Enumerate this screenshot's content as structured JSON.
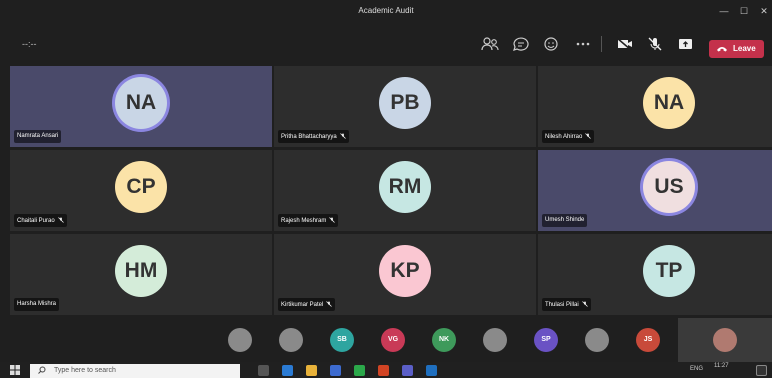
{
  "window": {
    "title": "Academic Audit"
  },
  "toolbar": {
    "timer": "--:--",
    "leave_label": "Leave",
    "leave_color": "#c4314b"
  },
  "colors": {
    "speaking_ring": "#8b86e0",
    "tile_bg": "#2d2d2d",
    "speaking_bg": "#4a4a6a"
  },
  "participants": [
    {
      "initials": "NA",
      "name": "Namrata Ansari",
      "muted": false,
      "speaking": true,
      "avatar_color": "#c9d6e6"
    },
    {
      "initials": "PB",
      "name": "Pritha Bhattacharyya",
      "muted": true,
      "speaking": false,
      "avatar_color": "#c9d6e6"
    },
    {
      "initials": "NA",
      "name": "Nilesh Ahirrao",
      "muted": true,
      "speaking": false,
      "avatar_color": "#fbe3a8"
    },
    {
      "initials": "CP",
      "name": "Chaitali Purao",
      "muted": true,
      "speaking": false,
      "avatar_color": "#fbe3a8"
    },
    {
      "initials": "RM",
      "name": "Rajesh Meshram",
      "muted": true,
      "speaking": false,
      "avatar_color": "#c6e7e3"
    },
    {
      "initials": "US",
      "name": "Umesh Shinde",
      "muted": false,
      "speaking": true,
      "avatar_color": "#f0dfe0"
    },
    {
      "initials": "HM",
      "name": "Harsha Mishra",
      "muted": false,
      "speaking": false,
      "avatar_color": "#d4ecd9"
    },
    {
      "initials": "KP",
      "name": "Kirtikumar Patel",
      "muted": true,
      "speaking": false,
      "avatar_color": "#fac7d2"
    },
    {
      "initials": "TP",
      "name": "Thulasi Pillai",
      "muted": true,
      "speaking": false,
      "avatar_color": "#c6e7e3"
    }
  ],
  "overflow": [
    {
      "kind": "photo"
    },
    {
      "kind": "photo"
    },
    {
      "initials": "SB",
      "color": "#2ea5a0"
    },
    {
      "initials": "VG",
      "color": "#c93a57"
    },
    {
      "initials": "NK",
      "color": "#3e9a5b"
    },
    {
      "kind": "photo"
    },
    {
      "initials": "SP",
      "color": "#6a52c4"
    },
    {
      "kind": "photo"
    },
    {
      "initials": "JS",
      "color": "#c84a3a"
    }
  ],
  "taskbar": {
    "search_placeholder": "Type here to search",
    "lang": "ENG",
    "time": "11:27"
  }
}
